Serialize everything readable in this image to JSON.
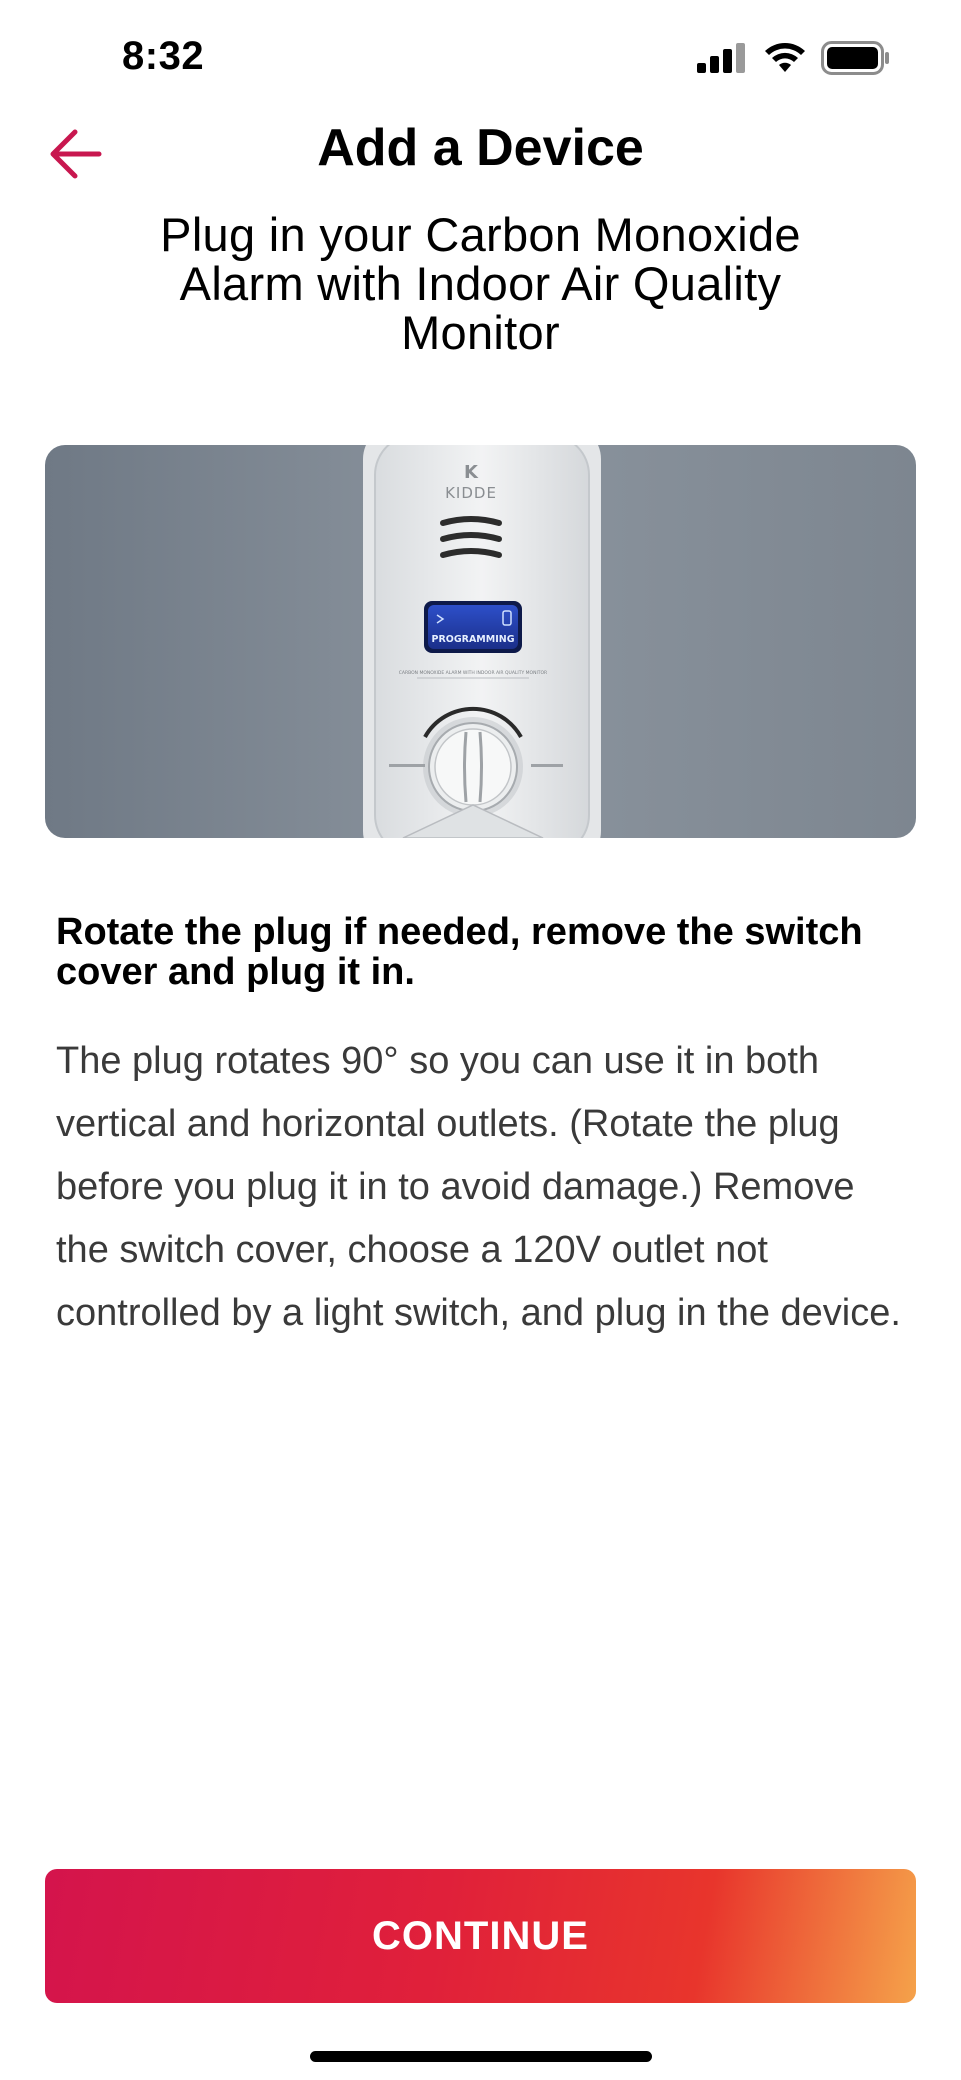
{
  "status_bar": {
    "time": "8:32",
    "icons": [
      "signal-icon",
      "wifi-icon",
      "battery-icon"
    ]
  },
  "header": {
    "title": "Add a Device",
    "back_icon": "arrow-left-icon"
  },
  "subtitle": "Plug in your Carbon Monoxide Alarm with Indoor Air Quality Monitor",
  "image": {
    "brand": "KIDDE",
    "display_text": "PROGRAMMING",
    "product_label": "CARBON MONOXIDE ALARM WITH INDOOR AIR QUALITY MONITOR"
  },
  "instruction": {
    "heading": "Rotate the plug if needed, remove the switch cover and plug it in.",
    "body": "The plug rotates 90° so you can use it in both vertical and horizontal outlets. (Rotate the plug before you plug it in to avoid damage.) Remove the switch cover, choose a 120V outlet not controlled by a light switch, and plug in the device."
  },
  "actions": {
    "continue_label": "CONTINUE"
  },
  "colors": {
    "accent": "#c8174f",
    "button_gradient_start": "#d4144c",
    "button_gradient_end": "#f5a24a"
  }
}
